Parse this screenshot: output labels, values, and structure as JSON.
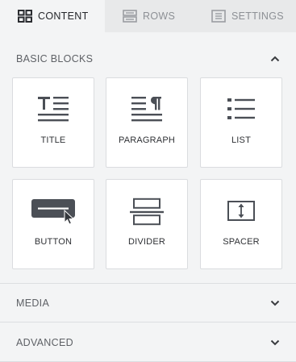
{
  "tabs": [
    {
      "label": "CONTENT",
      "icon": "grid-icon",
      "active": true
    },
    {
      "label": "ROWS",
      "icon": "rows-icon",
      "active": false
    },
    {
      "label": "SETTINGS",
      "icon": "settings-doc-icon",
      "active": false
    }
  ],
  "sections": {
    "basic": {
      "title": "BASIC BLOCKS",
      "expanded": true,
      "icon": "chevron-up-icon"
    },
    "media": {
      "title": "MEDIA",
      "expanded": false,
      "icon": "chevron-down-icon"
    },
    "advanced": {
      "title": "ADVANCED",
      "expanded": false,
      "icon": "chevron-down-icon"
    }
  },
  "blocks": [
    {
      "label": "TITLE",
      "icon": "title-icon"
    },
    {
      "label": "PARAGRAPH",
      "icon": "paragraph-icon"
    },
    {
      "label": "LIST",
      "icon": "list-icon"
    },
    {
      "label": "BUTTON",
      "icon": "button-icon"
    },
    {
      "label": "DIVIDER",
      "icon": "divider-icon"
    },
    {
      "label": "SPACER",
      "icon": "spacer-icon"
    }
  ],
  "colors": {
    "icon": "#4b4f56",
    "active_tab_bg": "#f3f4f5",
    "tab_bar_bg": "#e8e9ea",
    "card_bg": "#ffffff"
  }
}
